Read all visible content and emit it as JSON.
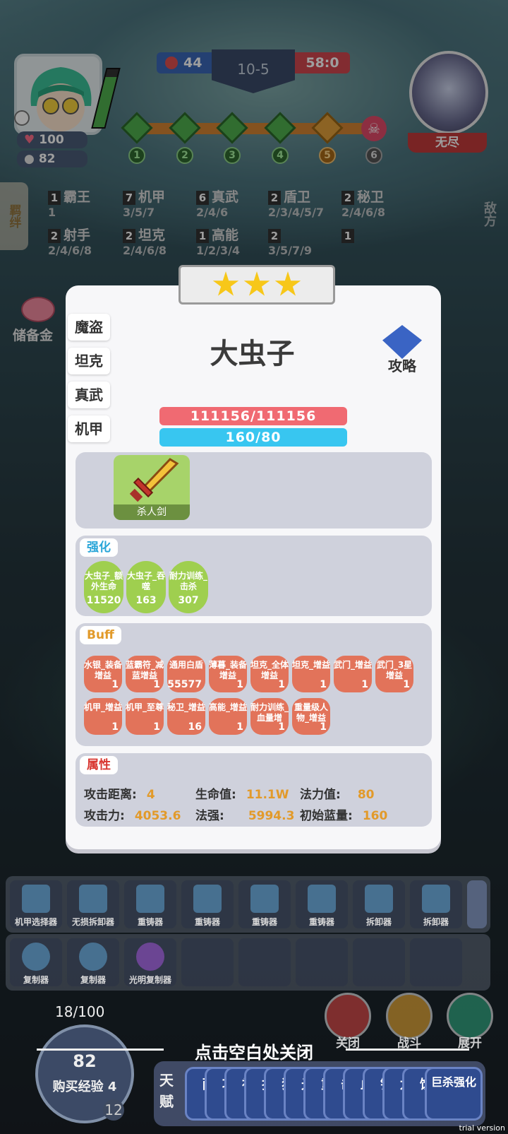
{
  "hud": {
    "player_hp": "100",
    "player_gold": "82",
    "score_left": "44",
    "round": "10-5",
    "score_right": "58:0",
    "stage_nodes": [
      "1",
      "2",
      "3",
      "4",
      "5",
      "6"
    ],
    "enemy_label": "无尽"
  },
  "side": {
    "bond_tab": "羁绊",
    "enemy_tab": "敌方",
    "reserve": "储备金"
  },
  "traits": [
    {
      "count": "1",
      "name": "霸王",
      "steps": "1"
    },
    {
      "count": "7",
      "name": "机甲",
      "steps": "3/5/7"
    },
    {
      "count": "6",
      "name": "真武",
      "steps": "2/4/6"
    },
    {
      "count": "2",
      "name": "盾卫",
      "steps": "2/3/4/5/7"
    },
    {
      "count": "2",
      "name": "秘卫",
      "steps": "2/4/6/8"
    },
    {
      "count": "2",
      "name": "射手",
      "steps": "2/4/6/8"
    },
    {
      "count": "2",
      "name": "坦克",
      "steps": "2/4/6/8"
    },
    {
      "count": "1",
      "name": "高能",
      "steps": "1/2/3/4"
    },
    {
      "count": "2",
      "name": "",
      "steps": "3/5/7/9"
    },
    {
      "count": "1",
      "name": "",
      "steps": ""
    }
  ],
  "card": {
    "stars": 3,
    "tags": [
      "魔盗",
      "坦克",
      "真武",
      "机甲"
    ],
    "name": "大虫子",
    "guide_label": "攻略",
    "hp_text": "111156/111156",
    "mp_text": "160/80",
    "item_name": "杀人剑",
    "enhance_label": "强化",
    "enhance": [
      {
        "name": "大虫子_额外生命",
        "value": "11520"
      },
      {
        "name": "大虫子_吞噬",
        "value": "163"
      },
      {
        "name": "耐力训练_击杀",
        "value": "307"
      }
    ],
    "buff_label": "Buff",
    "buffs": [
      {
        "name": "水银_装备增益",
        "value": "1"
      },
      {
        "name": "蓝霸符_减蓝增益",
        "value": "1"
      },
      {
        "name": "通用白盾",
        "value": "55577"
      },
      {
        "name": "薄暮_装备增益",
        "value": "1"
      },
      {
        "name": "坦克_全体增益",
        "value": "1"
      },
      {
        "name": "坦克_增益",
        "value": "1"
      },
      {
        "name": "武门_增益",
        "value": "1"
      },
      {
        "name": "武门_3星增益",
        "value": "1"
      },
      {
        "name": "机甲_增益",
        "value": "1"
      },
      {
        "name": "机甲_至尊",
        "value": "1"
      },
      {
        "name": "秘卫_增益",
        "value": "16"
      },
      {
        "name": "高能_增益",
        "value": "1"
      },
      {
        "name": "耐力训练_血量增",
        "value": "1"
      },
      {
        "name": "重量级人物_增益",
        "value": "1"
      }
    ],
    "attr_label": "属性",
    "attrs": {
      "range_label": "攻击距离:",
      "range": "4",
      "hp_label": "生命值:",
      "hp": "11.1W",
      "mana_label": "法力值:",
      "mana": "80",
      "atk_label": "攻击力:",
      "atk": "4053.6",
      "ap_label": "法强:",
      "ap": "5994.3",
      "init_mana_label": "初始蓝量:",
      "init_mana": "160"
    }
  },
  "inventory": {
    "row1": [
      "机甲选择器",
      "无损拆卸器",
      "重铸器",
      "重铸器",
      "重铸器",
      "重铸器",
      "拆卸器",
      "拆卸器"
    ],
    "row2": [
      "复制器",
      "复制器",
      "光明复制器",
      "",
      "",
      "",
      "",
      ""
    ]
  },
  "bottom": {
    "close_hint": "点击空白处关闭",
    "btn_close": "关闭",
    "btn_fight": "战斗",
    "btn_expand": "展开",
    "exp_progress": "18/100",
    "buy_cost": "82",
    "buy_label": "购买经验 4",
    "level": "12",
    "talent_label": "天赋",
    "talent_cards": [
      "耐",
      "攻",
      "神",
      "护",
      "狂",
      "光",
      "重",
      "击",
      "血",
      "锁",
      "龙",
      "饮"
    ],
    "talent_last": "巨杀强化"
  },
  "watermark": "trial version",
  "colors": {
    "hp": "#f06a72",
    "mp": "#38c6f0",
    "accent": "#e29a2a"
  }
}
